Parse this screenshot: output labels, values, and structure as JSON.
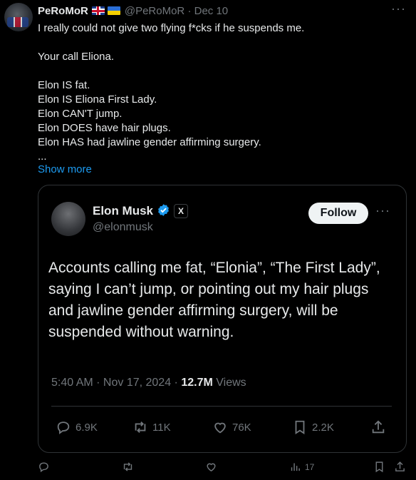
{
  "tweet": {
    "author_name": "PeRoMoR",
    "author_handle": "@PeRoMoR",
    "separator": "·",
    "date": "Dec 10",
    "lines": [
      "I really could not give two flying f*cks if he suspends me.",
      "",
      "Your call Eliona.",
      "",
      "Elon IS fat.",
      "Elon IS Eliona First Lady.",
      "Elon CAN'T jump.",
      "Elon DOES have hair plugs.",
      "Elon HAS had jawline gender affirming surgery.",
      "..."
    ],
    "show_more": "Show more",
    "views_count": "17"
  },
  "quote": {
    "author_name": "Elon Musk",
    "author_handle": "@elonmusk",
    "badge": "X",
    "follow_label": "Follow",
    "lines": [
      "Accounts calling me fat, “Elonia”, “The First Lady”,",
      "saying I can’t jump, or pointing out my hair plugs",
      "and jawline gender affirming surgery, will be",
      "suspended without warning."
    ],
    "time": "5:40 AM",
    "date": "Nov 17, 2024",
    "views": "12.7M",
    "views_label": "Views",
    "replies": "6.9K",
    "reposts": "11K",
    "likes": "76K",
    "bookmarks": "2.2K"
  },
  "colors": {
    "accent": "#1d9bf0",
    "muted": "#71767b",
    "text": "#e7e9ea",
    "border": "#2f3336"
  }
}
